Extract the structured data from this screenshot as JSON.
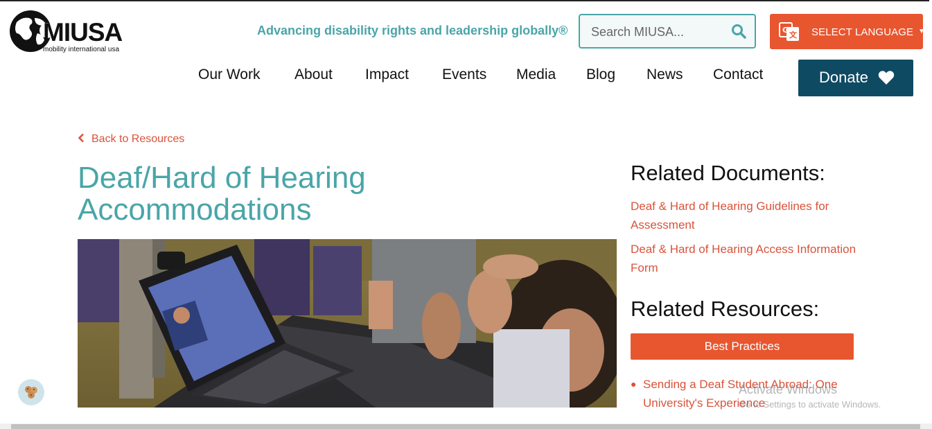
{
  "header": {
    "logo_text": "MIUSA",
    "logo_subtitle": "mobility international usa",
    "tagline": "Advancing disability rights and leadership globally®",
    "search": {
      "placeholder": "Search MIUSA..."
    },
    "language_button": "SELECT LANGUAGE",
    "donate_label": "Donate"
  },
  "nav": {
    "items": [
      {
        "label": "Our Work"
      },
      {
        "label": "About"
      },
      {
        "label": "Impact"
      },
      {
        "label": "Events"
      },
      {
        "label": "Media"
      },
      {
        "label": "Blog"
      },
      {
        "label": "News"
      },
      {
        "label": "Contact"
      }
    ]
  },
  "main": {
    "back_link": "Back to Resources",
    "title_line1": "Deaf/Hard of Hearing",
    "title_line2": "Accommodations"
  },
  "sidebar": {
    "related_documents_heading": "Related Documents:",
    "documents": [
      {
        "label": "Deaf & Hard of Hearing Guidelines for Assessment"
      },
      {
        "label": "Deaf & Hard of Hearing Access Information Form"
      }
    ],
    "related_resources_heading": "Related Resources:",
    "resource_category": "Best Practices",
    "resources": [
      {
        "label": "Sending a Deaf Student Abroad: One University's Experience"
      }
    ]
  },
  "overlay": {
    "watermark_title": "Activate Windows",
    "watermark_sub": "Go to Settings to activate Windows."
  },
  "colors": {
    "teal": "#4aa5a8",
    "orange": "#e8562f",
    "link": "#d9533a",
    "navy": "#0f4a63"
  }
}
